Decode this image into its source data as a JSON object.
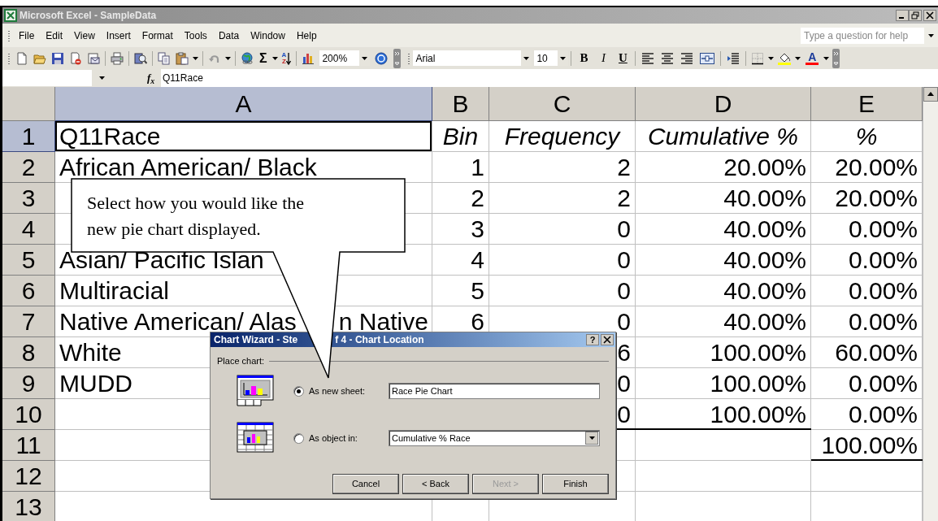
{
  "window": {
    "title": "Microsoft Excel - SampleData"
  },
  "menu": [
    "File",
    "Edit",
    "View",
    "Insert",
    "Format",
    "Tools",
    "Data",
    "Window",
    "Help"
  ],
  "help_search": {
    "placeholder": "Type a question for help"
  },
  "toolbar": {
    "autosum": "Σ",
    "sort": [
      "A",
      "Z"
    ],
    "zoom": "200%",
    "font": "Arial",
    "font_size": "10",
    "format_buttons": [
      {
        "label": "B",
        "kind": "bold"
      },
      {
        "label": "I",
        "kind": "italic"
      },
      {
        "label": "U",
        "kind": "underline"
      }
    ],
    "font_color": "A"
  },
  "formula_bar": {
    "label": "f$_{x}$",
    "value": "Q11Race"
  },
  "sheet": {
    "columns": [
      {
        "label": "A",
        "selected": true
      },
      {
        "label": "B",
        "selected": false
      },
      {
        "label": "C",
        "selected": false
      },
      {
        "label": "D",
        "selected": false
      },
      {
        "label": "E",
        "selected": false
      }
    ],
    "rows": [
      {
        "label": "1",
        "selected": true,
        "kind": "header",
        "cells": [
          "Q11Race",
          "Bin",
          "Frequency",
          "Cumulative %",
          "%"
        ],
        "bottom_border": [
          false,
          false,
          false,
          false,
          false
        ]
      },
      {
        "label": "2",
        "selected": false,
        "kind": "data",
        "cells": [
          "African American/ Black",
          "1",
          "2",
          "20.00%",
          "20.00%"
        ],
        "bottom_border": [
          false,
          false,
          false,
          false,
          false
        ]
      },
      {
        "label": "3",
        "selected": false,
        "kind": "data",
        "cells": [
          null,
          "2",
          "2",
          "40.00%",
          "20.00%"
        ],
        "bottom_border": [
          false,
          false,
          false,
          false,
          false
        ]
      },
      {
        "label": "4",
        "selected": false,
        "kind": "data",
        "cells": [
          null,
          "3",
          "0",
          "40.00%",
          "0.00%"
        ],
        "bottom_border": [
          false,
          false,
          false,
          false,
          false
        ]
      },
      {
        "label": "5",
        "selected": false,
        "kind": "data",
        "cells": [
          "Asian/ Pacific Islan",
          "4",
          "0",
          "40.00%",
          "0.00%"
        ],
        "bottom_border": [
          false,
          false,
          false,
          false,
          false
        ]
      },
      {
        "label": "6",
        "selected": false,
        "kind": "data",
        "cells": [
          "Multiracial",
          "5",
          "0",
          "40.00%",
          "0.00%"
        ],
        "bottom_border": [
          false,
          false,
          false,
          false,
          false
        ]
      },
      {
        "label": "7",
        "selected": false,
        "kind": "data",
        "cells": [
          [
            "Native American/ Alas",
            "n Native"
          ],
          "6",
          "0",
          "40.00%",
          "0.00%"
        ],
        "bottom_border": [
          false,
          false,
          false,
          false,
          false
        ]
      },
      {
        "label": "8",
        "selected": false,
        "kind": "data",
        "cells": [
          "White",
          null,
          "6",
          "100.00%",
          "60.00%"
        ],
        "bottom_border": [
          false,
          false,
          false,
          false,
          false
        ]
      },
      {
        "label": "9",
        "selected": false,
        "kind": "data",
        "cells": [
          "MUDD",
          null,
          "0",
          "100.00%",
          "0.00%"
        ],
        "bottom_border": [
          false,
          false,
          false,
          false,
          false
        ]
      },
      {
        "label": "10",
        "selected": false,
        "kind": "data",
        "cells": [
          null,
          null,
          "0",
          "100.00%",
          "0.00%"
        ],
        "bottom_border": [
          false,
          false,
          true,
          true,
          false
        ]
      },
      {
        "label": "11",
        "selected": false,
        "kind": "data",
        "cells": [
          null,
          null,
          null,
          null,
          "100.00%"
        ],
        "bottom_border": [
          false,
          false,
          false,
          false,
          true
        ]
      },
      {
        "label": "12",
        "selected": false,
        "kind": "data",
        "cells": [
          null,
          null,
          null,
          null,
          null
        ],
        "bottom_border": [
          false,
          false,
          false,
          false,
          false
        ]
      },
      {
        "label": "13",
        "selected": false,
        "kind": "data",
        "cells": [
          null,
          null,
          null,
          null,
          null
        ],
        "bottom_border": [
          false,
          false,
          false,
          false,
          false
        ]
      }
    ]
  },
  "callout": {
    "text": "Select how you would like the new pie chart displayed."
  },
  "dialog": {
    "title": [
      "Chart Wizard - Ste",
      "f 4 - Chart Location"
    ],
    "help_button": "?",
    "group_label": "Place chart:",
    "options": [
      {
        "label": "As new sheet:",
        "selected": true,
        "kind": "text",
        "value": "Race Pie Chart"
      },
      {
        "label": "As object in:",
        "selected": false,
        "kind": "dropdown",
        "value": "Cumulative % Race"
      }
    ],
    "buttons": [
      {
        "label": "Cancel",
        "disabled": false
      },
      {
        "label": "< Back",
        "disabled": false
      },
      {
        "label": "Next >",
        "disabled": true
      },
      {
        "label": "Finish",
        "disabled": false
      }
    ]
  }
}
